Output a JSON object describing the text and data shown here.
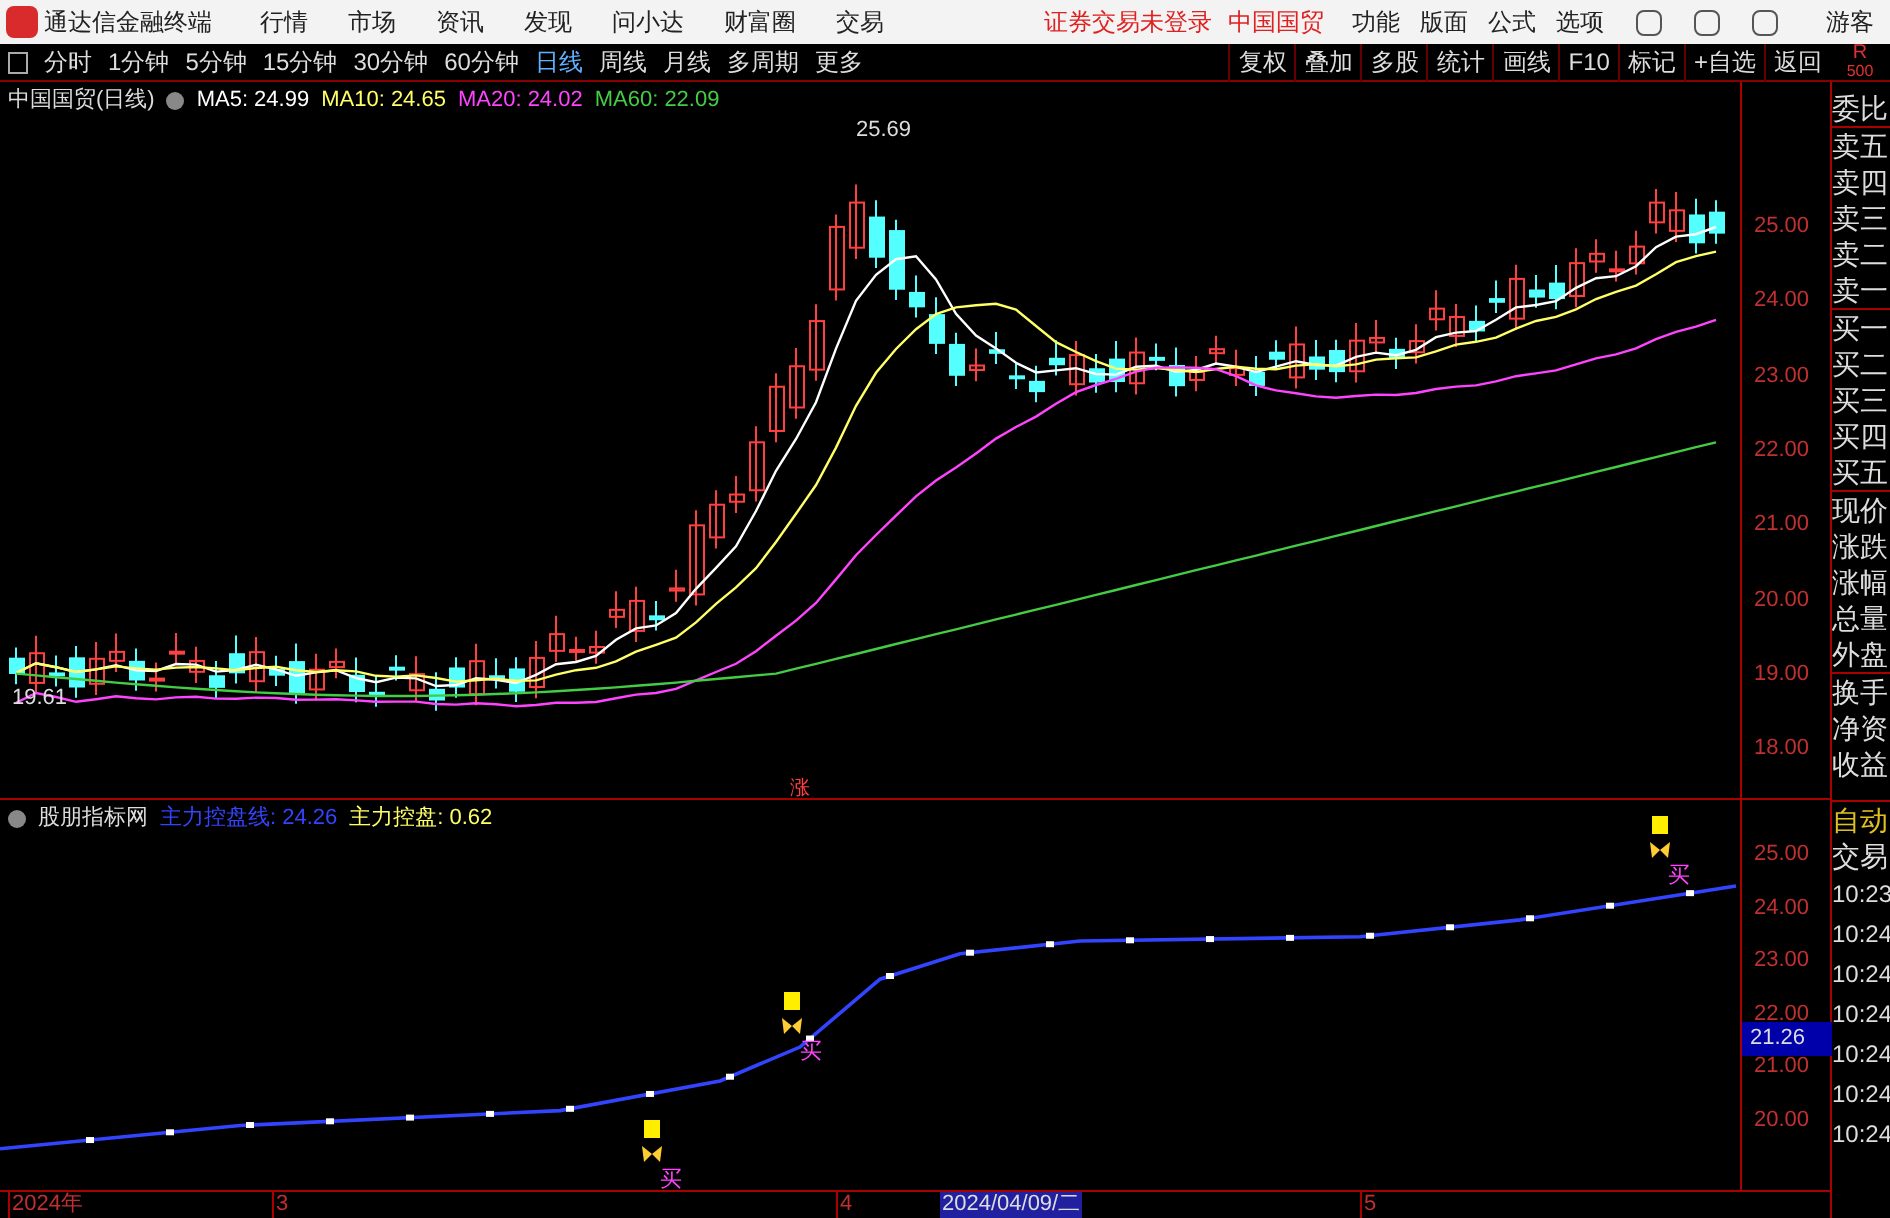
{
  "app": {
    "title": "通达信金融终端",
    "menu": [
      "行情",
      "市场",
      "资讯",
      "发现",
      "问小达",
      "财富圈",
      "交易"
    ],
    "notice": "证券交易未登录",
    "stock": "中国国贸",
    "tools": [
      "功能",
      "版面",
      "公式",
      "选项"
    ],
    "user": "游客"
  },
  "periods": [
    {
      "label": "分时",
      "selected": false
    },
    {
      "label": "1分钟",
      "selected": false
    },
    {
      "label": "5分钟",
      "selected": false
    },
    {
      "label": "15分钟",
      "selected": false
    },
    {
      "label": "30分钟",
      "selected": false
    },
    {
      "label": "60分钟",
      "selected": false
    },
    {
      "label": "日线",
      "selected": true
    },
    {
      "label": "周线",
      "selected": false
    },
    {
      "label": "月线",
      "selected": false
    },
    {
      "label": "多周期",
      "selected": false
    },
    {
      "label": "更多",
      "selected": false
    }
  ],
  "actions": [
    "复权",
    "叠加",
    "多股",
    "统计",
    "画线",
    "F10",
    "标记",
    "+自选",
    "返回"
  ],
  "corner": [
    "R",
    "500"
  ],
  "main_chart": {
    "title": "中国国贸(日线)",
    "ma": [
      {
        "label": "MA5: 24.99",
        "color": "#ffffff"
      },
      {
        "label": "MA10: 24.65",
        "color": "#ffff66"
      },
      {
        "label": "MA20: 24.02",
        "color": "#ff44ff"
      },
      {
        "label": "MA60: 22.09",
        "color": "#44cc44"
      }
    ],
    "y_ticks": [
      "25.00",
      "24.00",
      "23.00",
      "22.00",
      "21.00",
      "20.00",
      "19.00",
      "18.00"
    ],
    "high_label": "25.69",
    "low_label": "19.61",
    "marker": "涨"
  },
  "quote_panel": [
    "委比",
    "卖五",
    "卖四",
    "卖三",
    "卖二",
    "卖一",
    "买一",
    "买二",
    "买三",
    "买四",
    "买五",
    "现价",
    "涨跌",
    "涨幅",
    "总量",
    "外盘",
    "换手",
    "净资",
    "收益"
  ],
  "indicator": {
    "title": "股朋指标网",
    "lines": [
      {
        "label": "主力控盘线: 24.26",
        "color": "#3344ff"
      },
      {
        "label": "主力控盘: 0.62",
        "color": "#ffff66"
      }
    ],
    "y_ticks": [
      "25.00",
      "24.00",
      "23.00",
      "22.00",
      "21.00",
      "20.00"
    ],
    "price_tag": "21.26",
    "signals": [
      "买",
      "买",
      "买"
    ]
  },
  "trade_panel": {
    "tabs": [
      "自动",
      "交易"
    ],
    "times": [
      "10:23",
      "10:24",
      "10:24",
      "10:24",
      "10:24",
      "10:24",
      "10:24"
    ]
  },
  "x_axis": [
    {
      "label": "2024年",
      "selected": false
    },
    {
      "label": "3",
      "selected": false
    },
    {
      "label": "4",
      "selected": false
    },
    {
      "label": "2024/04/09/二",
      "selected": true
    },
    {
      "label": "5",
      "selected": false
    }
  ]
}
